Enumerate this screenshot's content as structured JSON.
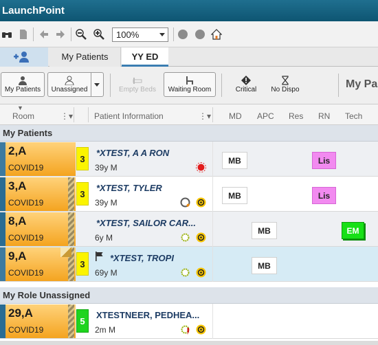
{
  "window": {
    "title": "LaunchPoint"
  },
  "toolbar": {
    "zoom_value": "100%",
    "icons": [
      "binoculars-icon",
      "page-icon",
      "back-icon",
      "forward-icon",
      "zoom-out-icon",
      "zoom-in-icon",
      "circle-icon",
      "circle-icon",
      "home-icon"
    ]
  },
  "tabs": [
    {
      "label": "My Patients"
    },
    {
      "label": "YY ED"
    }
  ],
  "filters": {
    "my_patients": "My Patients",
    "unassigned": "Unassigned",
    "empty_beds": "Empty Beds",
    "waiting_room": "Waiting Room",
    "critical": "Critical",
    "no_dispo": "No Dispo",
    "my_pa": "My Pa"
  },
  "columns": {
    "room": "Room",
    "patient_info": "Patient Information",
    "md": "MD",
    "apc": "APC",
    "res": "Res",
    "rn": "RN",
    "tech": "Tech"
  },
  "groups": {
    "my_patients": "My Patients",
    "unassigned": "My Role Unassigned"
  },
  "rows": [
    {
      "room": "2,A",
      "dx": "COVID19",
      "acuity": "3",
      "name": "*XTEST, A A RON",
      "age": "39y M",
      "md": "MB",
      "rn": "Lis"
    },
    {
      "room": "3,A",
      "dx": "COVID19",
      "acuity": "3",
      "name": "*XTEST, TYLER",
      "age": "39y M",
      "md": "MB",
      "rn": "Lis"
    },
    {
      "room": "8,A",
      "dx": "COVID19",
      "acuity": "",
      "name": "*XTEST, SAILOR CAR...",
      "age": "6y M",
      "apc": "MB",
      "tech": "EM"
    },
    {
      "room": "9,A",
      "dx": "COVID19",
      "acuity": "3",
      "name": "*XTEST, TROPI",
      "age": "69y M",
      "apc": "MB"
    },
    {
      "room": "29,A",
      "dx": "COVID19",
      "acuity": "5",
      "name": "XTESTNEER, PEDHEA...",
      "age": "2m M"
    }
  ],
  "colors": {
    "title_bar": "#0e5572",
    "acuity_yellow": "#fbf400",
    "acuity_green": "#1fd41f",
    "rn_pink": "#f28af0",
    "tech_green": "#17e017",
    "room_orange": "#f4a420"
  }
}
